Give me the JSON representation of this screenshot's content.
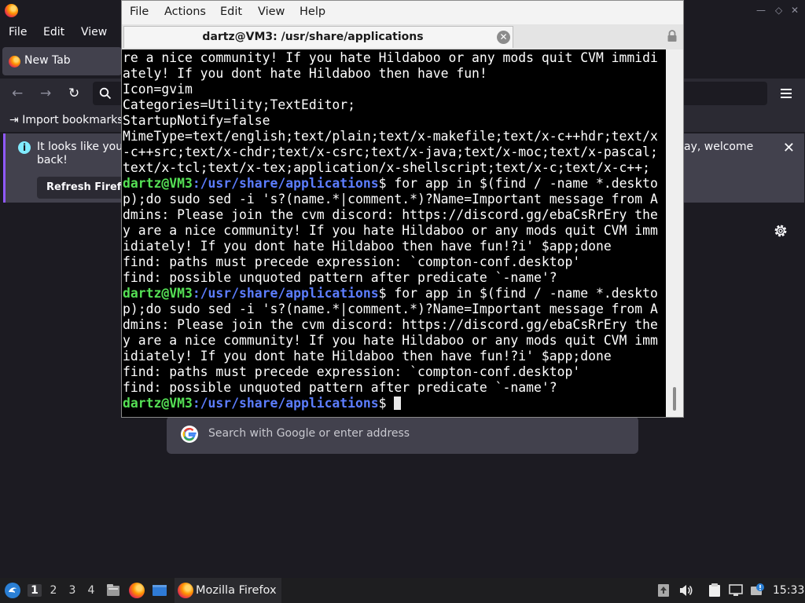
{
  "firefox": {
    "menu": [
      "File",
      "Edit",
      "View"
    ],
    "tab_label": "New Tab",
    "bookmarks_import": "Import bookmarks",
    "notification": {
      "text_part1": "It looks like you l",
      "text_part2": "ay, welcome",
      "text_part3": "back!",
      "refresh_label": "Refresh Firefo",
      "close_label": "✕"
    },
    "search_placeholder": "Search with Google or enter address"
  },
  "terminal": {
    "menu": [
      "File",
      "Actions",
      "Edit",
      "View",
      "Help"
    ],
    "tab_title": "dartz@VM3: /usr/share/applications",
    "prompt": {
      "user_host": "dartz@VM3",
      "path": ":/usr/share/applications"
    },
    "lines": [
      {
        "text": "re a nice community! If you hate Hildaboo or any mods quit CVM immidi"
      },
      {
        "text": "ately! If you dont hate Hildaboo then have fun!"
      },
      {
        "text": "Icon=gvim"
      },
      {
        "text": "Categories=Utility;TextEditor;"
      },
      {
        "text": "StartupNotify=false"
      },
      {
        "text": "MimeType=text/english;text/plain;text/x-makefile;text/x-c++hdr;text/x"
      },
      {
        "text": "-c++src;text/x-chdr;text/x-csrc;text/x-java;text/x-moc;text/x-pascal;"
      },
      {
        "text": "text/x-tcl;text/x-tex;application/x-shellscript;text/x-c;text/x-c++;"
      },
      {
        "prompt": true,
        "text": "$ for app in $(find / -name *.deskto"
      },
      {
        "text": "p);do sudo sed -i 's?(name.*|comment.*)?Name=Important message from A"
      },
      {
        "text": "dmins: Please join the cvm discord: https://discord.gg/ebaCsRrEry the"
      },
      {
        "text": "y are a nice community! If you hate Hildaboo or any mods quit CVM imm"
      },
      {
        "text": "idiately! If you dont hate Hildaboo then have fun!?i' $app;done"
      },
      {
        "text": "find: paths must precede expression: `compton-conf.desktop'"
      },
      {
        "text": "find: possible unquoted pattern after predicate `-name'?"
      },
      {
        "prompt": true,
        "text": "$ for app in $(find / -name *.deskto"
      },
      {
        "text": "p);do sudo sed -i 's?(name.*|comment.*)?Name=Important message from A"
      },
      {
        "text": "dmins: Please join the cvm discord: https://discord.gg/ebaCsRrEry the"
      },
      {
        "text": "y are a nice community! If you hate Hildaboo or any mods quit CVM imm"
      },
      {
        "text": "idiately! If you dont hate Hildaboo then have fun!?i' $app;done"
      },
      {
        "text": "find: paths must precede expression: `compton-conf.desktop'"
      },
      {
        "text": "find: possible unquoted pattern after predicate `-name'?"
      },
      {
        "prompt": true,
        "text": "$ ",
        "cursor": true
      }
    ]
  },
  "taskbar": {
    "workspaces": [
      "1",
      "2",
      "3",
      "4"
    ],
    "active_workspace": "1",
    "task_label": "Mozilla Firefox",
    "clock": "15:33"
  },
  "colors": {
    "prompt_user": "#55e055",
    "prompt_path": "#5c7dff",
    "terminal_bg": "#000000",
    "firefox_bg": "#1c1b22",
    "accent": "#9059ff"
  }
}
